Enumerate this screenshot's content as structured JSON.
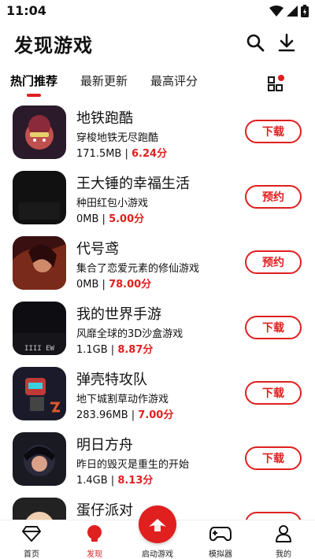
{
  "status": {
    "time": "11:04"
  },
  "header": {
    "title": "发现游戏",
    "search_icon": "search-icon",
    "download_icon": "download-icon"
  },
  "tabs": [
    {
      "label": "热门推荐",
      "active": true
    },
    {
      "label": "最新更新",
      "active": false
    },
    {
      "label": "最高评分",
      "active": false
    }
  ],
  "accent": "#e01f1f",
  "games": [
    {
      "name": "地铁跑酷",
      "desc": "穿梭地铁无尽跑酷",
      "size": "171.5MB",
      "score": "6.24分",
      "action": "下载"
    },
    {
      "name": "王大锤的幸福生活",
      "desc": "种田红包小游戏",
      "size": "0MB",
      "score": "5.00分",
      "action": "预约"
    },
    {
      "name": "代号鸢",
      "desc": "集合了恋爱元素的修仙游戏",
      "size": "0MB",
      "score": "78.00分",
      "action": "预约"
    },
    {
      "name": "我的世界手游",
      "desc": "风靡全球的3D沙盒游戏",
      "size": "1.1GB",
      "score": "8.87分",
      "action": "下载"
    },
    {
      "name": "弹壳特攻队",
      "desc": "地下城割草动作游戏",
      "size": "283.96MB",
      "score": "7.00分",
      "action": "下载"
    },
    {
      "name": "明日方舟",
      "desc": "昨日的毁灭是重生的开始",
      "size": "1.4GB",
      "score": "8.13分",
      "action": "下载"
    },
    {
      "name": "蛋仔派对",
      "desc": "",
      "size": "",
      "score": "",
      "action": ""
    }
  ],
  "icon_texts": {
    "minecraft": "IIII EW"
  },
  "nav": [
    {
      "label": "首页",
      "icon": "diamond-icon",
      "active": false
    },
    {
      "label": "发现",
      "icon": "bulb-icon",
      "active": true
    },
    {
      "label": "启动游戏",
      "icon": "launch-icon",
      "active": false
    },
    {
      "label": "模拟器",
      "icon": "gamepad-icon",
      "active": false
    },
    {
      "label": "我的",
      "icon": "profile-icon",
      "active": false
    }
  ]
}
